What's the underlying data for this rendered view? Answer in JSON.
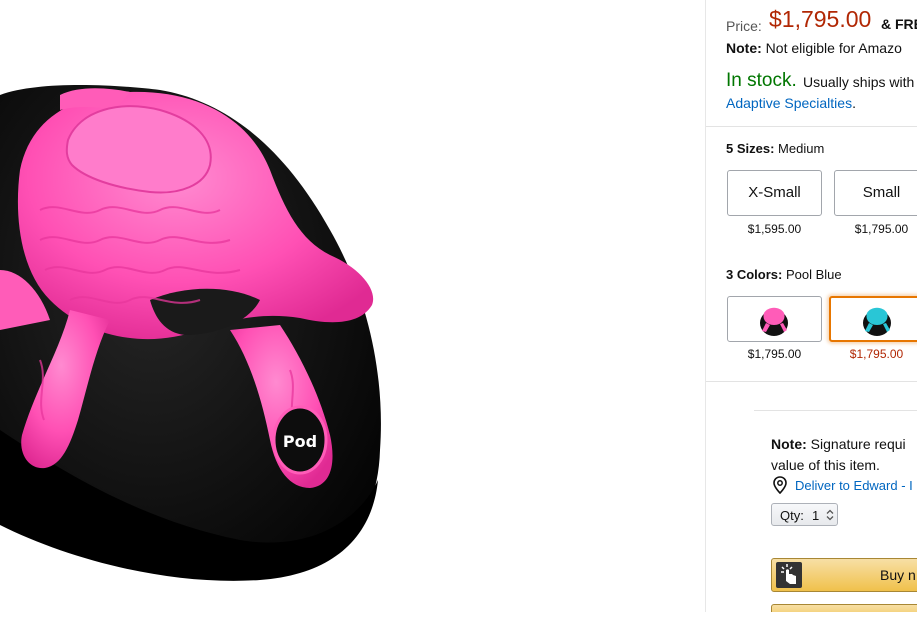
{
  "price": {
    "label": "Price:",
    "value": "$1,795.00",
    "free": "& FRE"
  },
  "note": {
    "bold": "Note:",
    "text": "Not eligible for Amazo"
  },
  "stock": {
    "status": "In stock.",
    "ships": "Usually ships with",
    "seller": "Adaptive Specialties",
    "period": "."
  },
  "sizes": {
    "label_bold": "5 Sizes:",
    "label_value": "Medium",
    "options": [
      {
        "name": "X-Small",
        "price": "$1,595.00"
      },
      {
        "name": "Small",
        "price": "$1,795.00"
      }
    ]
  },
  "colors": {
    "label_bold": "3 Colors:",
    "label_value": "Pool Blue",
    "options": [
      {
        "name": "pink",
        "price": "$1,795.00",
        "swatch_color": "#ff5db8"
      },
      {
        "name": "pool-blue",
        "price": "$1,795.00",
        "swatch_color": "#29c6d6",
        "selected": true
      }
    ]
  },
  "signature": {
    "bold": "Note:",
    "line1": "Signature requi",
    "line2": "value of this item."
  },
  "deliver": {
    "text": "Deliver to Edward - I",
    "icon": "location-pin-icon"
  },
  "qty": {
    "label": "Qty:",
    "value": "1"
  },
  "buy_now": {
    "label": "Buy n"
  },
  "product_image": {
    "logo_text": "Pod",
    "primary_color": "#ff4fb0",
    "base_color": "#0e0e0e"
  },
  "colors_palette": {
    "price_red": "#b12704",
    "stock_green": "#007600",
    "link_blue": "#0066c0",
    "button_yellow": "#f0c14b"
  }
}
